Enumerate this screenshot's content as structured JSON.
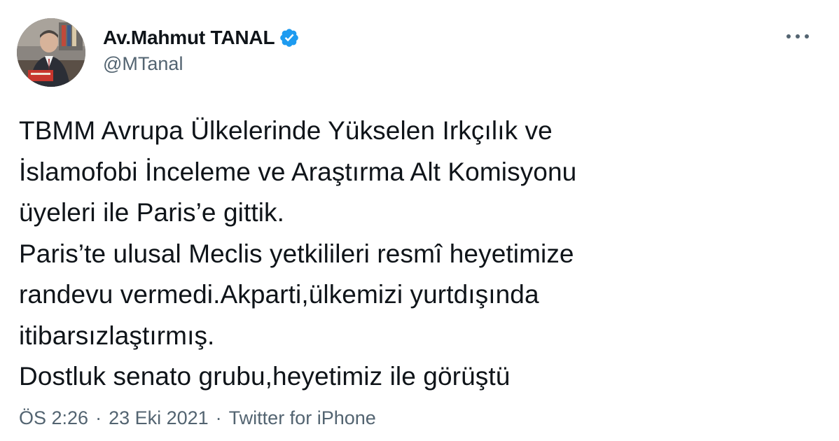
{
  "author": {
    "display_name": "Av.Mahmut TANAL",
    "handle": "@MTanal",
    "verified": true,
    "verified_color": "#1d9bf0"
  },
  "tweet": {
    "lines": [
      "TBMM Avrupa Ülkelerinde Yükselen Irkçılık ve",
      "İslamofobi İnceleme ve Araştırma Alt Komisyonu",
      "üyeleri ile Paris’e gittik.",
      "Paris’te ulusal Meclis yetkilileri resmî heyetimize",
      "randevu vermedi.Akparti,ülkemizi yurtdışında",
      "itibarsızlaştırmış.",
      "Dostluk senato grubu,heyetimiz ile görüştü"
    ]
  },
  "meta": {
    "time": "ÖS 2:26",
    "separator": "·",
    "date": "23 Eki 2021",
    "source": "Twitter for iPhone"
  },
  "icons": {
    "more": "more-horizontal-icon",
    "verified": "verified-badge-icon"
  },
  "colors": {
    "text": "#0f1419",
    "secondary": "#536471",
    "accent": "#1d9bf0"
  }
}
